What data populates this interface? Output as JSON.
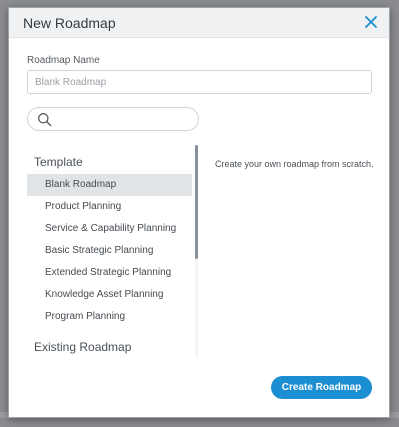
{
  "dialog": {
    "title": "New Roadmap",
    "close_icon": "close-icon",
    "accent_color": "#1b8fd1"
  },
  "name_field": {
    "label": "Roadmap Name",
    "value": "",
    "placeholder": "Blank Roadmap"
  },
  "search": {
    "icon": "search-icon",
    "value": ""
  },
  "groups": [
    {
      "heading": "Template",
      "items": [
        {
          "label": "Blank Roadmap",
          "selected": true
        },
        {
          "label": "Product Planning",
          "selected": false
        },
        {
          "label": "Service & Capability Planning",
          "selected": false
        },
        {
          "label": "Basic Strategic Planning",
          "selected": false
        },
        {
          "label": "Extended Strategic Planning",
          "selected": false
        },
        {
          "label": "Knowledge Asset Planning",
          "selected": false
        },
        {
          "label": "Program Planning",
          "selected": false
        }
      ]
    },
    {
      "heading": "Existing Roadmap",
      "items": []
    }
  ],
  "description": "Create your own roadmap from scratch.",
  "footer": {
    "create_label": "Create Roadmap"
  }
}
